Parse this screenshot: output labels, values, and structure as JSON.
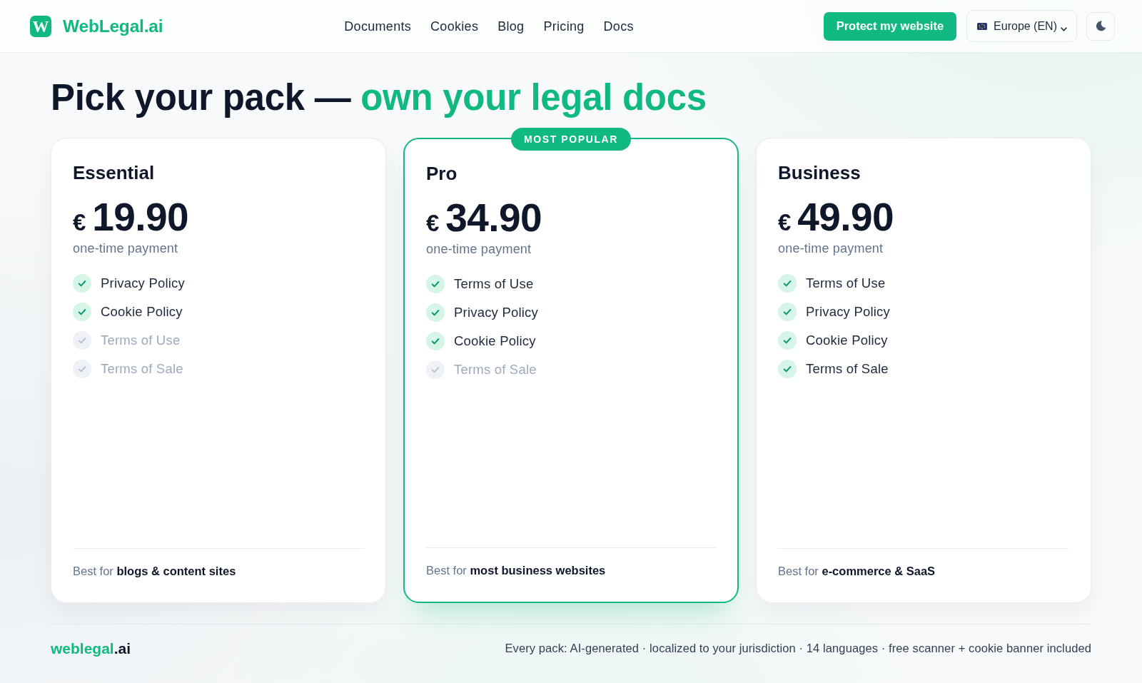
{
  "navbar": {
    "logo_letter": "W",
    "brand": "WebLegal.ai",
    "links": [
      "Documents",
      "Cookies",
      "Blog",
      "Pricing",
      "Docs"
    ],
    "cta": "Protect my website",
    "region": "Europe (EN)"
  },
  "heading": {
    "text": "Pick your pack —",
    "highlight": "own your legal docs"
  },
  "plans": [
    {
      "name": "Essential",
      "currency": "€",
      "price": "19.90",
      "billing": "one-time payment",
      "featured": false,
      "features": [
        {
          "label": "Privacy Policy",
          "included": true
        },
        {
          "label": "Cookie Policy",
          "included": true
        },
        {
          "label": "Terms of Use",
          "included": false
        },
        {
          "label": "Terms of Sale",
          "included": false
        }
      ],
      "best_for": "Best for **blogs & content sites**"
    },
    {
      "name": "Pro",
      "badge": "MOST POPULAR",
      "currency": "€",
      "price": "34.90",
      "billing": "one-time payment",
      "featured": true,
      "features": [
        {
          "label": "Terms of Use",
          "included": true
        },
        {
          "label": "Privacy Policy",
          "included": true
        },
        {
          "label": "Cookie Policy",
          "included": true
        },
        {
          "label": "Terms of Sale",
          "included": false
        }
      ],
      "best_for": "Best for **most business websites**"
    },
    {
      "name": "Business",
      "currency": "€",
      "price": "49.90",
      "billing": "one-time payment",
      "featured": false,
      "features": [
        {
          "label": "Terms of Use",
          "included": true
        },
        {
          "label": "Privacy Policy",
          "included": true
        },
        {
          "label": "Cookie Policy",
          "included": true
        },
        {
          "label": "Terms of Sale",
          "included": true
        }
      ],
      "best_for": "Best for **e-commerce & SaaS**"
    }
  ],
  "footer": {
    "brand": "weblegal",
    "brand_suffix": ".ai",
    "note": "Every pack: AI-generated · localized to your jurisdiction · 14 languages · free scanner + cookie banner included"
  }
}
